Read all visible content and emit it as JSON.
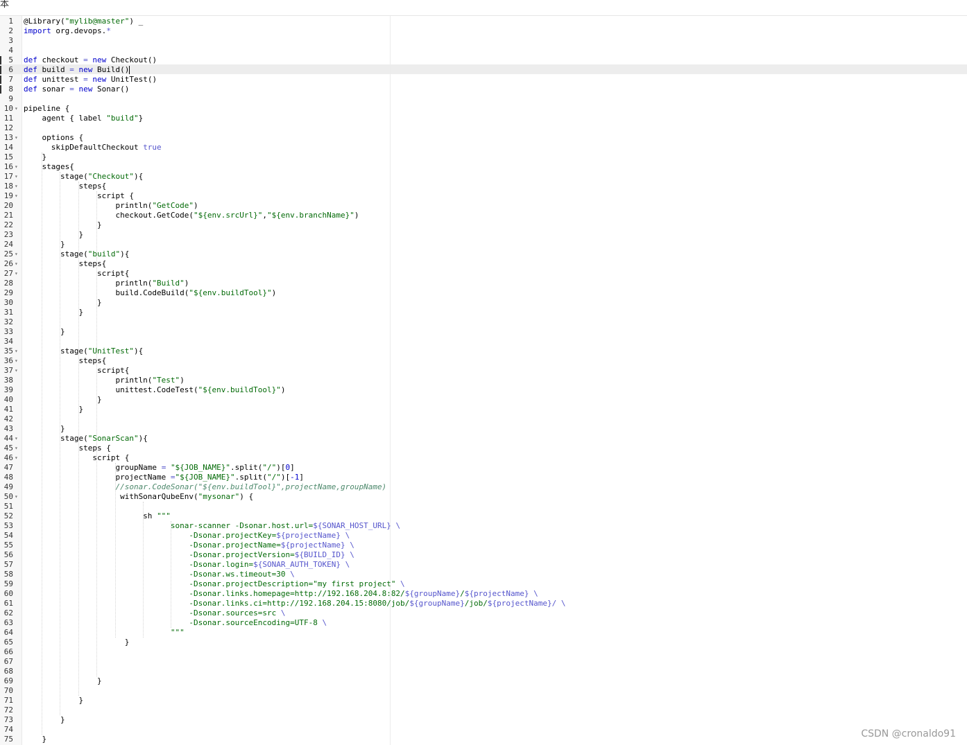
{
  "topbar": {
    "glyph": "本"
  },
  "editor": {
    "active_line": 6,
    "lines": [
      {
        "n": "1",
        "fold": false,
        "tokens": [
          {
            "t": "@Library(",
            "c": ""
          },
          {
            "t": "\"mylib@master\"",
            "c": "s"
          },
          {
            "t": ") _",
            "c": ""
          }
        ]
      },
      {
        "n": "2",
        "fold": false,
        "tokens": [
          {
            "t": "import",
            "c": "k"
          },
          {
            "t": " org.devops.",
            "c": ""
          },
          {
            "t": "*",
            "c": "v"
          }
        ]
      },
      {
        "n": "3",
        "fold": false,
        "tokens": []
      },
      {
        "n": "4",
        "fold": false,
        "tokens": []
      },
      {
        "n": "5",
        "fold": false,
        "tokens": [
          {
            "t": "def",
            "c": "k"
          },
          {
            "t": " checkout ",
            "c": ""
          },
          {
            "t": "=",
            "c": "v"
          },
          {
            "t": " ",
            "c": ""
          },
          {
            "t": "new",
            "c": "k"
          },
          {
            "t": " Checkout()",
            "c": ""
          }
        ]
      },
      {
        "n": "6",
        "fold": false,
        "cursor": true,
        "tokens": [
          {
            "t": "def",
            "c": "k"
          },
          {
            "t": " build ",
            "c": ""
          },
          {
            "t": "=",
            "c": "v"
          },
          {
            "t": " ",
            "c": ""
          },
          {
            "t": "new",
            "c": "k"
          },
          {
            "t": " Build()",
            "c": ""
          }
        ]
      },
      {
        "n": "7",
        "fold": false,
        "tokens": [
          {
            "t": "def",
            "c": "k"
          },
          {
            "t": " unittest ",
            "c": ""
          },
          {
            "t": "=",
            "c": "v"
          },
          {
            "t": " ",
            "c": ""
          },
          {
            "t": "new",
            "c": "k"
          },
          {
            "t": " UnitTest()",
            "c": ""
          }
        ]
      },
      {
        "n": "8",
        "fold": false,
        "tokens": [
          {
            "t": "def",
            "c": "k"
          },
          {
            "t": " sonar ",
            "c": ""
          },
          {
            "t": "=",
            "c": "v"
          },
          {
            "t": " ",
            "c": ""
          },
          {
            "t": "new",
            "c": "k"
          },
          {
            "t": " Sonar()",
            "c": ""
          }
        ]
      },
      {
        "n": "9",
        "fold": false,
        "tokens": []
      },
      {
        "n": "10",
        "fold": true,
        "tokens": [
          {
            "t": "pipeline {",
            "c": ""
          }
        ]
      },
      {
        "n": "11",
        "fold": false,
        "tokens": [
          {
            "t": "    agent { label ",
            "c": ""
          },
          {
            "t": "\"build\"",
            "c": "s"
          },
          {
            "t": "}",
            "c": ""
          }
        ]
      },
      {
        "n": "12",
        "fold": false,
        "tokens": []
      },
      {
        "n": "13",
        "fold": true,
        "tokens": [
          {
            "t": "    options {",
            "c": ""
          }
        ]
      },
      {
        "n": "14",
        "fold": false,
        "tokens": [
          {
            "t": "      skipDefaultCheckout ",
            "c": ""
          },
          {
            "t": "true",
            "c": "v"
          }
        ]
      },
      {
        "n": "15",
        "fold": false,
        "tokens": [
          {
            "t": "    }",
            "c": ""
          }
        ]
      },
      {
        "n": "16",
        "fold": true,
        "tokens": [
          {
            "t": "    stages{",
            "c": ""
          }
        ]
      },
      {
        "n": "17",
        "fold": true,
        "tokens": [
          {
            "t": "        stage(",
            "c": ""
          },
          {
            "t": "\"Checkout\"",
            "c": "s"
          },
          {
            "t": "){",
            "c": ""
          }
        ]
      },
      {
        "n": "18",
        "fold": true,
        "tokens": [
          {
            "t": "            steps{",
            "c": ""
          }
        ]
      },
      {
        "n": "19",
        "fold": true,
        "tokens": [
          {
            "t": "                script {",
            "c": ""
          }
        ]
      },
      {
        "n": "20",
        "fold": false,
        "tokens": [
          {
            "t": "                    println(",
            "c": ""
          },
          {
            "t": "\"GetCode\"",
            "c": "s"
          },
          {
            "t": ")",
            "c": ""
          }
        ]
      },
      {
        "n": "21",
        "fold": false,
        "tokens": [
          {
            "t": "                    checkout.GetCode(",
            "c": ""
          },
          {
            "t": "\"${env.srcUrl}\"",
            "c": "s"
          },
          {
            "t": ",",
            "c": ""
          },
          {
            "t": "\"${env.branchName}\"",
            "c": "s"
          },
          {
            "t": ")",
            "c": ""
          }
        ]
      },
      {
        "n": "22",
        "fold": false,
        "tokens": [
          {
            "t": "                }",
            "c": ""
          }
        ]
      },
      {
        "n": "23",
        "fold": false,
        "tokens": [
          {
            "t": "            }",
            "c": ""
          }
        ]
      },
      {
        "n": "24",
        "fold": false,
        "tokens": [
          {
            "t": "        }",
            "c": ""
          }
        ]
      },
      {
        "n": "25",
        "fold": true,
        "tokens": [
          {
            "t": "        stage(",
            "c": ""
          },
          {
            "t": "\"build\"",
            "c": "s"
          },
          {
            "t": "){",
            "c": ""
          }
        ]
      },
      {
        "n": "26",
        "fold": true,
        "tokens": [
          {
            "t": "            steps{",
            "c": ""
          }
        ]
      },
      {
        "n": "27",
        "fold": true,
        "tokens": [
          {
            "t": "                script{",
            "c": ""
          }
        ]
      },
      {
        "n": "28",
        "fold": false,
        "tokens": [
          {
            "t": "                    println(",
            "c": ""
          },
          {
            "t": "\"Build\"",
            "c": "s"
          },
          {
            "t": ")",
            "c": ""
          }
        ]
      },
      {
        "n": "29",
        "fold": false,
        "tokens": [
          {
            "t": "                    build.CodeBuild(",
            "c": ""
          },
          {
            "t": "\"${env.buildTool}\"",
            "c": "s"
          },
          {
            "t": ")",
            "c": ""
          }
        ]
      },
      {
        "n": "30",
        "fold": false,
        "tokens": [
          {
            "t": "                }",
            "c": ""
          }
        ]
      },
      {
        "n": "31",
        "fold": false,
        "tokens": [
          {
            "t": "            }",
            "c": ""
          }
        ]
      },
      {
        "n": "32",
        "fold": false,
        "tokens": []
      },
      {
        "n": "33",
        "fold": false,
        "tokens": [
          {
            "t": "        }",
            "c": ""
          }
        ]
      },
      {
        "n": "34",
        "fold": false,
        "tokens": []
      },
      {
        "n": "35",
        "fold": true,
        "tokens": [
          {
            "t": "        stage(",
            "c": ""
          },
          {
            "t": "\"UnitTest\"",
            "c": "s"
          },
          {
            "t": "){",
            "c": ""
          }
        ]
      },
      {
        "n": "36",
        "fold": true,
        "tokens": [
          {
            "t": "            steps{",
            "c": ""
          }
        ]
      },
      {
        "n": "37",
        "fold": true,
        "tokens": [
          {
            "t": "                script{",
            "c": ""
          }
        ]
      },
      {
        "n": "38",
        "fold": false,
        "tokens": [
          {
            "t": "                    println(",
            "c": ""
          },
          {
            "t": "\"Test\"",
            "c": "s"
          },
          {
            "t": ")",
            "c": ""
          }
        ]
      },
      {
        "n": "39",
        "fold": false,
        "tokens": [
          {
            "t": "                    unittest.CodeTest(",
            "c": ""
          },
          {
            "t": "\"${env.buildTool}\"",
            "c": "s"
          },
          {
            "t": ")",
            "c": ""
          }
        ]
      },
      {
        "n": "40",
        "fold": false,
        "tokens": [
          {
            "t": "                }",
            "c": ""
          }
        ]
      },
      {
        "n": "41",
        "fold": false,
        "tokens": [
          {
            "t": "            }",
            "c": ""
          }
        ]
      },
      {
        "n": "42",
        "fold": false,
        "tokens": []
      },
      {
        "n": "43",
        "fold": false,
        "tokens": [
          {
            "t": "        }",
            "c": ""
          }
        ]
      },
      {
        "n": "44",
        "fold": true,
        "tokens": [
          {
            "t": "        stage(",
            "c": ""
          },
          {
            "t": "\"SonarScan\"",
            "c": "s"
          },
          {
            "t": "){",
            "c": ""
          }
        ]
      },
      {
        "n": "45",
        "fold": true,
        "tokens": [
          {
            "t": "            steps {",
            "c": ""
          }
        ]
      },
      {
        "n": "46",
        "fold": true,
        "tokens": [
          {
            "t": "               script {",
            "c": ""
          }
        ]
      },
      {
        "n": "47",
        "fold": false,
        "tokens": [
          {
            "t": "                    groupName ",
            "c": ""
          },
          {
            "t": "=",
            "c": "v"
          },
          {
            "t": " ",
            "c": ""
          },
          {
            "t": "\"${JOB_NAME}\"",
            "c": "s"
          },
          {
            "t": ".split(",
            "c": ""
          },
          {
            "t": "\"/\"",
            "c": "s"
          },
          {
            "t": ")[",
            "c": ""
          },
          {
            "t": "0",
            "c": "n"
          },
          {
            "t": "]",
            "c": ""
          }
        ]
      },
      {
        "n": "48",
        "fold": false,
        "tokens": [
          {
            "t": "                    projectName ",
            "c": ""
          },
          {
            "t": "=",
            "c": "v"
          },
          {
            "t": "\"${JOB_NAME}\"",
            "c": "s"
          },
          {
            "t": ".split(",
            "c": ""
          },
          {
            "t": "\"/\"",
            "c": "s"
          },
          {
            "t": ")[",
            "c": ""
          },
          {
            "t": "-1",
            "c": "n"
          },
          {
            "t": "]",
            "c": ""
          }
        ]
      },
      {
        "n": "49",
        "fold": false,
        "tokens": [
          {
            "t": "                    ",
            "c": ""
          },
          {
            "t": "//sonar.CodeSonar(\"${env.buildTool}\",projectName,groupName)",
            "c": "c"
          }
        ]
      },
      {
        "n": "50",
        "fold": true,
        "tokens": [
          {
            "t": "                     withSonarQubeEnv(",
            "c": ""
          },
          {
            "t": "\"mysonar\"",
            "c": "s"
          },
          {
            "t": ") {",
            "c": ""
          }
        ]
      },
      {
        "n": "51",
        "fold": false,
        "tokens": []
      },
      {
        "n": "52",
        "fold": false,
        "tokens": [
          {
            "t": "                          sh ",
            "c": ""
          },
          {
            "t": "\"\"\"",
            "c": "s"
          }
        ]
      },
      {
        "n": "53",
        "fold": false,
        "tokens": [
          {
            "t": "                                ",
            "c": ""
          },
          {
            "t": "sonar-scanner -Dsonar.host.url=",
            "c": "s"
          },
          {
            "t": "${SONAR_HOST_URL}",
            "c": "v"
          },
          {
            "t": " \\",
            "c": "v"
          }
        ]
      },
      {
        "n": "54",
        "fold": false,
        "tokens": [
          {
            "t": "                                    ",
            "c": ""
          },
          {
            "t": "-Dsonar.projectKey=",
            "c": "s"
          },
          {
            "t": "${projectName}",
            "c": "v"
          },
          {
            "t": " \\",
            "c": "v"
          }
        ]
      },
      {
        "n": "55",
        "fold": false,
        "tokens": [
          {
            "t": "                                    ",
            "c": ""
          },
          {
            "t": "-Dsonar.projectName=",
            "c": "s"
          },
          {
            "t": "${projectName}",
            "c": "v"
          },
          {
            "t": " \\",
            "c": "v"
          }
        ]
      },
      {
        "n": "56",
        "fold": false,
        "tokens": [
          {
            "t": "                                    ",
            "c": ""
          },
          {
            "t": "-Dsonar.projectVersion=",
            "c": "s"
          },
          {
            "t": "${BUILD_ID}",
            "c": "v"
          },
          {
            "t": " \\",
            "c": "v"
          }
        ]
      },
      {
        "n": "57",
        "fold": false,
        "tokens": [
          {
            "t": "                                    ",
            "c": ""
          },
          {
            "t": "-Dsonar.login=",
            "c": "s"
          },
          {
            "t": "${SONAR_AUTH_TOKEN}",
            "c": "v"
          },
          {
            "t": " \\",
            "c": "v"
          }
        ]
      },
      {
        "n": "58",
        "fold": false,
        "tokens": [
          {
            "t": "                                    ",
            "c": ""
          },
          {
            "t": "-Dsonar.ws.timeout=30",
            "c": "s"
          },
          {
            "t": " \\",
            "c": "v"
          }
        ]
      },
      {
        "n": "59",
        "fold": false,
        "tokens": [
          {
            "t": "                                    ",
            "c": ""
          },
          {
            "t": "-Dsonar.projectDescription=\"my first project\"",
            "c": "s"
          },
          {
            "t": " \\",
            "c": "v"
          }
        ]
      },
      {
        "n": "60",
        "fold": false,
        "tokens": [
          {
            "t": "                                    ",
            "c": ""
          },
          {
            "t": "-Dsonar.links.homepage=http://192.168.204.8:82/",
            "c": "s"
          },
          {
            "t": "${groupName}",
            "c": "v"
          },
          {
            "t": "/",
            "c": "s"
          },
          {
            "t": "${projectName}",
            "c": "v"
          },
          {
            "t": " \\",
            "c": "v"
          }
        ]
      },
      {
        "n": "61",
        "fold": false,
        "tokens": [
          {
            "t": "                                    ",
            "c": ""
          },
          {
            "t": "-Dsonar.links.ci=http://192.168.204.15:8080/job/",
            "c": "s"
          },
          {
            "t": "${groupName}",
            "c": "v"
          },
          {
            "t": "/job/",
            "c": "s"
          },
          {
            "t": "${projectName}",
            "c": "v"
          },
          {
            "t": "/ \\",
            "c": "v"
          }
        ]
      },
      {
        "n": "62",
        "fold": false,
        "tokens": [
          {
            "t": "                                    ",
            "c": ""
          },
          {
            "t": "-Dsonar.sources=src",
            "c": "s"
          },
          {
            "t": " \\",
            "c": "v"
          }
        ]
      },
      {
        "n": "63",
        "fold": false,
        "tokens": [
          {
            "t": "                                    ",
            "c": ""
          },
          {
            "t": "-Dsonar.sourceEncoding=UTF-8",
            "c": "s"
          },
          {
            "t": " \\",
            "c": "v"
          }
        ]
      },
      {
        "n": "64",
        "fold": false,
        "tokens": [
          {
            "t": "                                ",
            "c": ""
          },
          {
            "t": "\"\"\"",
            "c": "s"
          }
        ]
      },
      {
        "n": "65",
        "fold": false,
        "tokens": [
          {
            "t": "                      }",
            "c": ""
          }
        ]
      },
      {
        "n": "66",
        "fold": false,
        "tokens": []
      },
      {
        "n": "67",
        "fold": false,
        "tokens": []
      },
      {
        "n": "68",
        "fold": false,
        "tokens": []
      },
      {
        "n": "69",
        "fold": false,
        "tokens": [
          {
            "t": "                }",
            "c": ""
          }
        ]
      },
      {
        "n": "70",
        "fold": false,
        "tokens": []
      },
      {
        "n": "71",
        "fold": false,
        "tokens": [
          {
            "t": "            }",
            "c": ""
          }
        ]
      },
      {
        "n": "72",
        "fold": false,
        "tokens": []
      },
      {
        "n": "73",
        "fold": false,
        "tokens": [
          {
            "t": "        }",
            "c": ""
          }
        ]
      },
      {
        "n": "74",
        "fold": false,
        "tokens": []
      },
      {
        "n": "75",
        "fold": false,
        "tokens": [
          {
            "t": "    }",
            "c": ""
          }
        ]
      }
    ],
    "breakpoint_lines": [
      "5",
      "6",
      "7",
      "8"
    ]
  },
  "watermark": {
    "text": "CSDN @cronaldo91"
  }
}
